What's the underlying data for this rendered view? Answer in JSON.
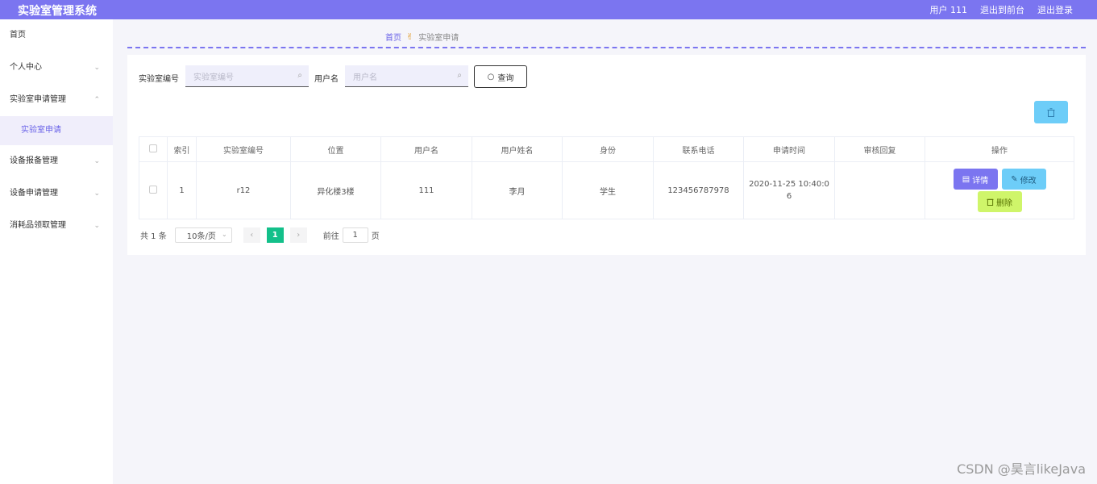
{
  "header": {
    "title": "实验室管理系统",
    "user": "用户 111",
    "exit_front": "退出到前台",
    "logout": "退出登录"
  },
  "sidebar": {
    "items": [
      {
        "label": "首页",
        "chevron": ""
      },
      {
        "label": "个人中心",
        "chevron": "⌄"
      },
      {
        "label": "实验室申请管理",
        "chevron": "⌃"
      },
      {
        "label": "设备报备管理",
        "chevron": "⌄"
      },
      {
        "label": "设备申请管理",
        "chevron": "⌄"
      },
      {
        "label": "消耗品领取管理",
        "chevron": "⌄"
      }
    ],
    "active_sub": "实验室申请"
  },
  "breadcrumb": {
    "home": "首页",
    "separator_icon": "hand-icon",
    "current": "实验室申请"
  },
  "search": {
    "field1_label": "实验室编号",
    "field1_placeholder": "实验室编号",
    "field2_label": "用户名",
    "field2_placeholder": "用户名",
    "query_label": "查询"
  },
  "table": {
    "columns": [
      "索引",
      "实验室编号",
      "位置",
      "用户名",
      "用户姓名",
      "身份",
      "联系电话",
      "申请时间",
      "审核回复",
      "操作"
    ],
    "rows": [
      {
        "index": "1",
        "lab_no": "r12",
        "location": "异化楼3楼",
        "username": "111",
        "name": "李月",
        "role": "学生",
        "phone": "123456787978",
        "time_line1": "2020-11-25 10:40:0",
        "time_line2": "6",
        "reply": "",
        "detail": "详情",
        "edit": "修改",
        "delete": "删除"
      }
    ]
  },
  "pager": {
    "total": "共 1 条",
    "page_size": "10条/页",
    "prev": "‹",
    "current_page": "1",
    "next": "›",
    "goto_prefix": "前往",
    "goto_value": "1",
    "goto_suffix": "页"
  },
  "watermark": "CSDN @昊言likeJava",
  "colors": {
    "header": "#7b75f0",
    "detail_btn": "#7b75f0",
    "edit_btn": "#6dcdf8",
    "delete_btn": "#cff56a",
    "page_active": "#13c08a"
  }
}
